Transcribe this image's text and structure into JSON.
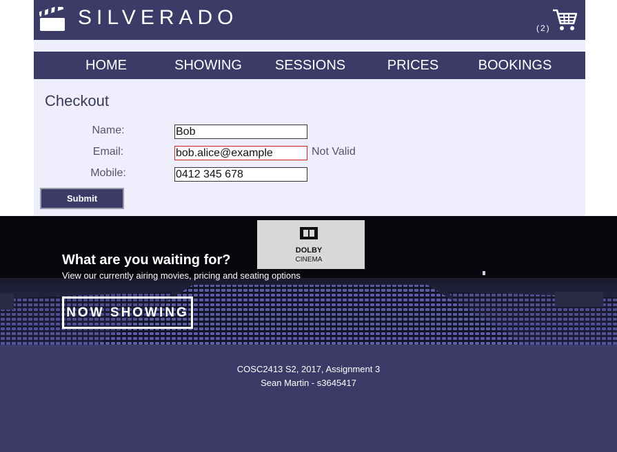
{
  "header": {
    "brand": "SILVERADO",
    "cart_count": "(2)",
    "logo_icon": "clapperboard-icon",
    "cart_icon": "shopping-cart-icon"
  },
  "nav": {
    "items": [
      "HOME",
      "SHOWING",
      "SESSIONS",
      "PRICES",
      "BOOKINGS"
    ]
  },
  "checkout": {
    "title": "Checkout",
    "name_label": "Name:",
    "name_value": "Bob",
    "email_label": "Email:",
    "email_value": "bob.alice@example",
    "email_error": "Not Valid",
    "mobile_label": "Mobile:",
    "mobile_value": "0412 345 678",
    "submit_label": "Submit"
  },
  "hero": {
    "headline": "What are you waiting for?",
    "subtext": "View our currently airing movies, pricing and seating options",
    "cta_label": "NOW SHOWING",
    "screen_logo_line1": "DOLBY",
    "screen_logo_line2": "CINEMA"
  },
  "footer": {
    "line1": "COSC2413 S2, 2017, Assignment 3",
    "line2": "Sean Martin - s3645417"
  },
  "colors": {
    "primary": "#3c3a66",
    "background_light": "#efeefc",
    "error_border": "#cc1f1f"
  }
}
